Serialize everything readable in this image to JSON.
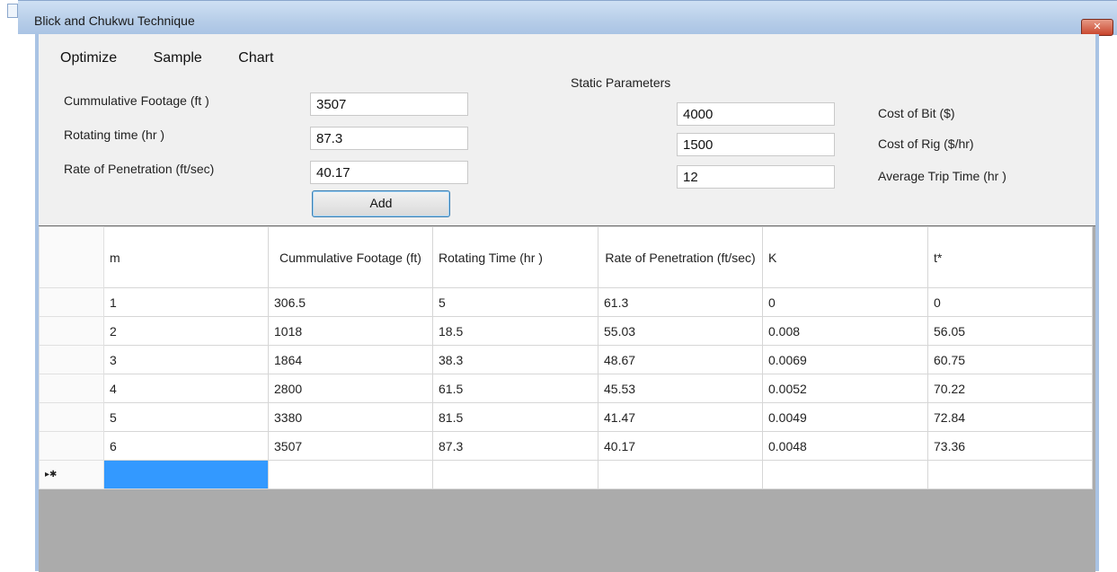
{
  "window": {
    "title": "Blick and Chukwu Technique",
    "close": "✕"
  },
  "menu": [
    "Optimize",
    "Sample",
    "Chart"
  ],
  "inputs": {
    "footage_label": "Cummulative Footage (ft )",
    "footage_value": "3507",
    "rotating_label": "Rotating time (hr )",
    "rotating_value": "87.3",
    "rop_label": "Rate of Penetration (ft/sec)",
    "rop_value": "40.17",
    "add_label": "Add"
  },
  "static": {
    "heading": "Static Parameters",
    "bit_value": "4000",
    "bit_label": "Cost of Bit ($)",
    "rig_value": "1500",
    "rig_label": "Cost of Rig ($/hr)",
    "trip_value": "12",
    "trip_label": "Average Trip Time (hr )"
  },
  "table": {
    "columns": [
      "m",
      "Cummulative Footage (ft)",
      "Rotating Time (hr )",
      "Rate of Penetration (ft/sec)",
      "K",
      "t*"
    ],
    "rows": [
      [
        "1",
        "306.5",
        "5",
        "61.3",
        "0",
        "0"
      ],
      [
        "2",
        "1018",
        "18.5",
        "55.03",
        "0.008",
        "56.05"
      ],
      [
        "3",
        "1864",
        "38.3",
        "48.67",
        "0.0069",
        "60.75"
      ],
      [
        "4",
        "2800",
        "61.5",
        "45.53",
        "0.0052",
        "70.22"
      ],
      [
        "5",
        "3380",
        "81.5",
        "41.47",
        "0.0049",
        "72.84"
      ],
      [
        "6",
        "3507",
        "87.3",
        "40.17",
        "0.0048",
        "73.36"
      ]
    ],
    "new_row_marker": "▸✱"
  }
}
